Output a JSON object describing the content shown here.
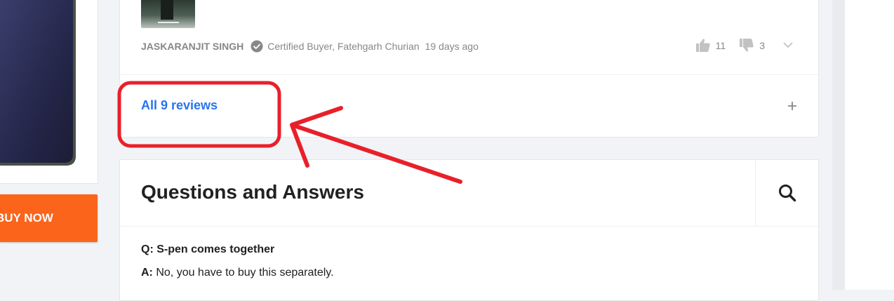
{
  "product": {
    "buy_now_label": "BUY NOW"
  },
  "review": {
    "reviewer_name": "JASKARANJIT SINGH",
    "verified_icon": "check-circle-icon",
    "buyer_text": "Certified Buyer, Fatehgarh Churian",
    "date": "19 days ago",
    "likes": "11",
    "dislikes": "3"
  },
  "reviews_section": {
    "all_reviews_label": "All 9 reviews",
    "expand_icon": "plus-icon"
  },
  "qa": {
    "title": "Questions and Answers",
    "search_icon": "search-icon",
    "question_prefix": "Q:",
    "question_text": "S-pen comes together",
    "answer_prefix": "A:",
    "answer_text": "No, you have to buy this separately."
  },
  "annotation": {
    "color": "#e8202a"
  },
  "colors": {
    "link": "#2874f0",
    "buy_now": "#fb641b",
    "muted": "#878787"
  }
}
